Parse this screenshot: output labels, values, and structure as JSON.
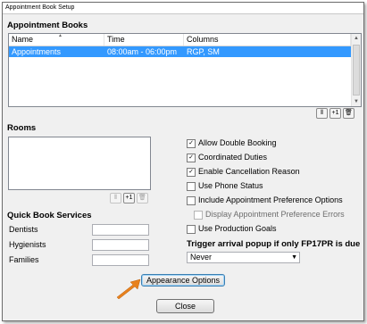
{
  "window": {
    "title": "Appointment Book Setup"
  },
  "appointment_books": {
    "heading": "Appointment Books",
    "columns": [
      "Name",
      "Time",
      "Columns"
    ],
    "rows": [
      {
        "name": "Appointments",
        "time": "08:00am - 06:00pm",
        "columns": "RGP, SM"
      }
    ]
  },
  "rooms": {
    "heading": "Rooms"
  },
  "toolbar_icons": [
    "columns-icon",
    "add-icon",
    "delete-icon"
  ],
  "toolbar_glyphs": {
    "columns": "⫴",
    "add": "+1",
    "delete": "🗑"
  },
  "checkboxes": [
    {
      "label": "Allow Double Booking",
      "checked": true,
      "enabled": true
    },
    {
      "label": "Coordinated Duties",
      "checked": true,
      "enabled": true
    },
    {
      "label": "Enable Cancellation Reason",
      "checked": true,
      "enabled": true
    },
    {
      "label": "Use Phone Status",
      "checked": false,
      "enabled": true
    },
    {
      "label": "Include Appointment Preference Options",
      "checked": false,
      "enabled": true
    },
    {
      "label": "Display Appointment Preference Errors",
      "checked": false,
      "enabled": false
    },
    {
      "label": "Use Production Goals",
      "checked": false,
      "enabled": true
    }
  ],
  "check_glyph": "✓",
  "quick_book": {
    "heading": "Quick Book Services",
    "fields": [
      {
        "label": "Dentists",
        "value": ""
      },
      {
        "label": "Hygienists",
        "value": ""
      },
      {
        "label": "Families",
        "value": ""
      }
    ]
  },
  "trigger": {
    "label": "Trigger arrival popup if only FP17PR is due",
    "selected": "Never"
  },
  "buttons": {
    "appearance": "Appearance Options",
    "close": "Close"
  },
  "colors": {
    "selection": "#3399ff",
    "annotation_arrow": "#e8821e"
  }
}
